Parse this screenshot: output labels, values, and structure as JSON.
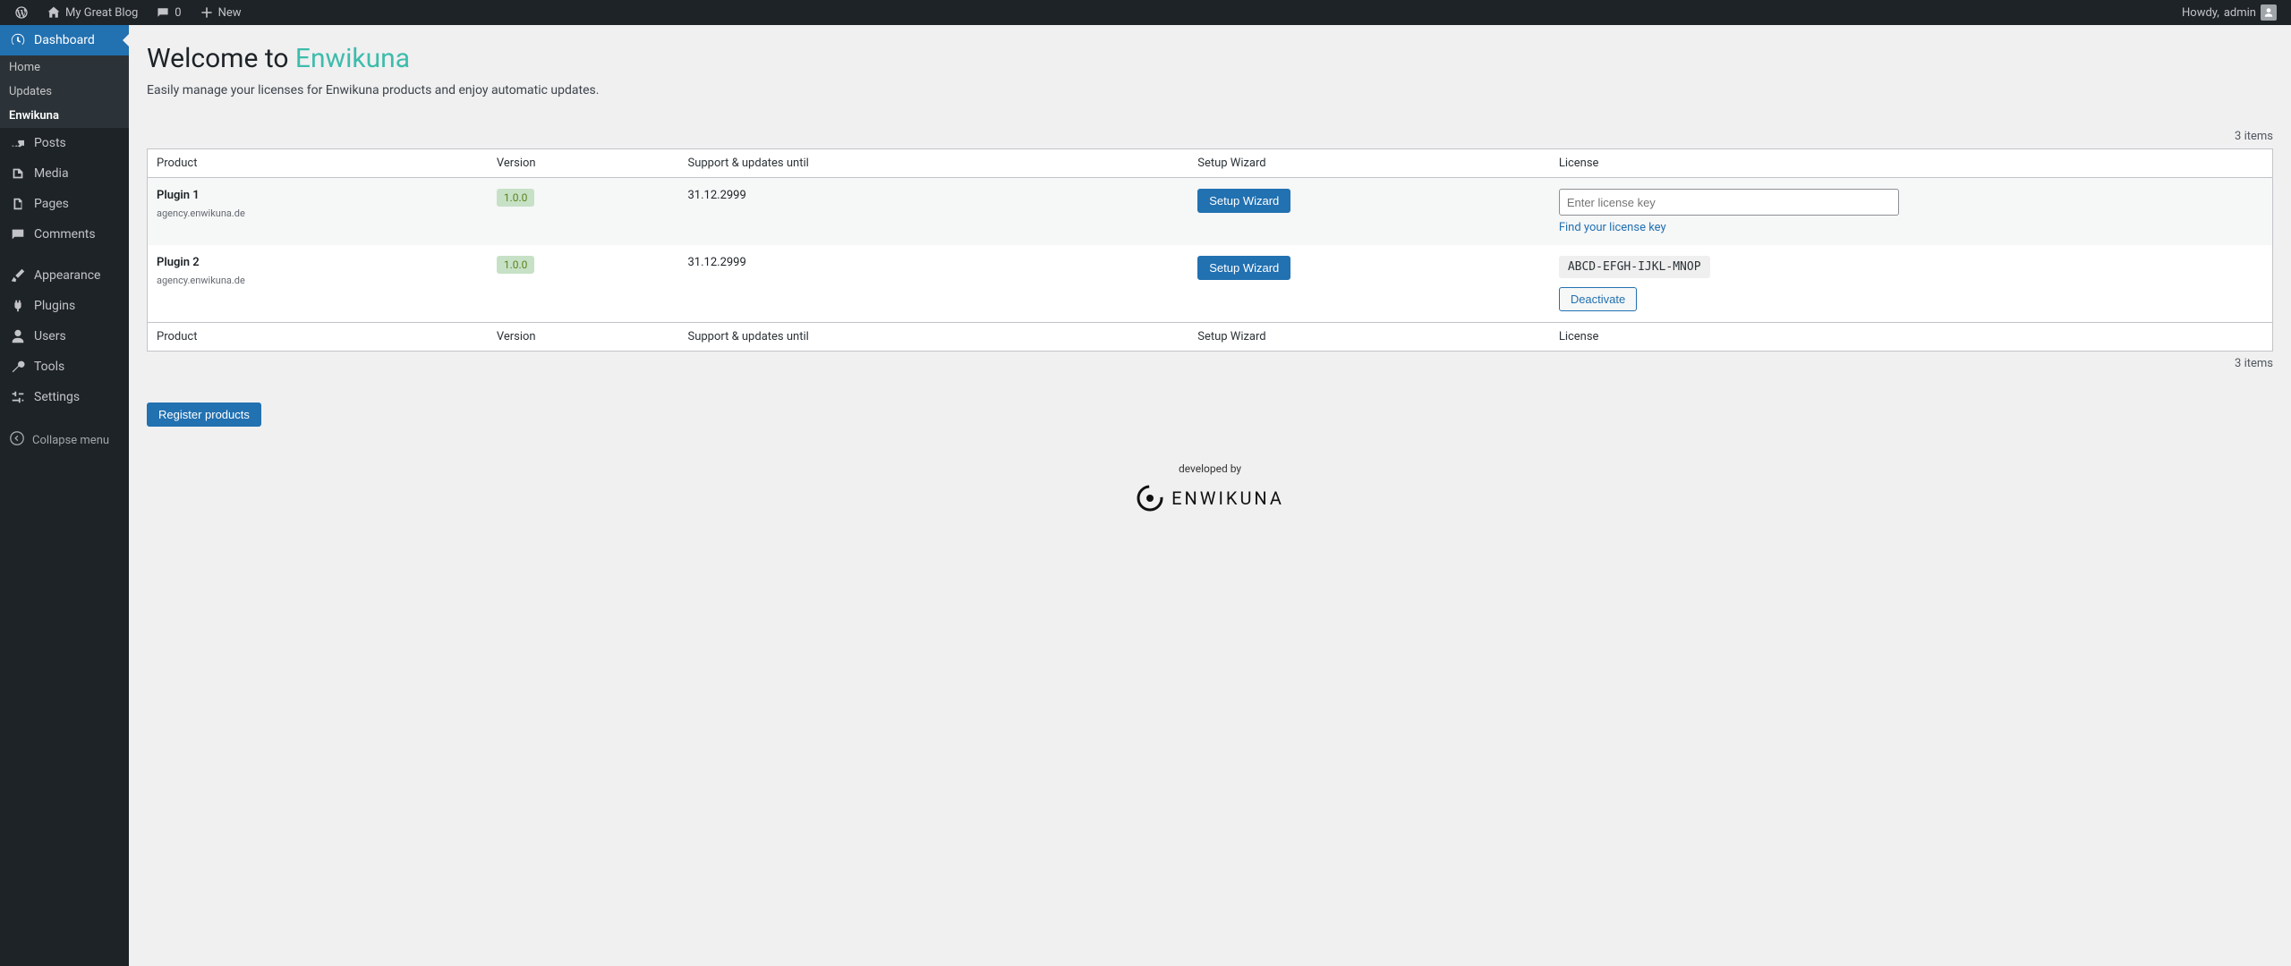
{
  "adminbar": {
    "site_name": "My Great Blog",
    "comments_count": "0",
    "new_label": "New",
    "howdy_prefix": "Howdy,",
    "user": "admin"
  },
  "sidebar": {
    "dashboard": "Dashboard",
    "submenu": {
      "home": "Home",
      "updates": "Updates",
      "enwikuna": "Enwikuna"
    },
    "posts": "Posts",
    "media": "Media",
    "pages": "Pages",
    "comments": "Comments",
    "appearance": "Appearance",
    "plugins": "Plugins",
    "users": "Users",
    "tools": "Tools",
    "settings": "Settings",
    "collapse": "Collapse menu"
  },
  "page": {
    "title_prefix": "Welcome to ",
    "title_brand": "Enwikuna",
    "subtitle": "Easily manage your licenses for Enwikuna products and enjoy automatic updates.",
    "items_count_top": "3 items",
    "items_count_bottom": "3 items",
    "register_button": "Register products",
    "developed_by": "developed by",
    "footer_brand": "ENWIKUNA"
  },
  "table": {
    "headers": {
      "product": "Product",
      "version": "Version",
      "support": "Support & updates until",
      "wizard": "Setup Wizard",
      "license": "License"
    },
    "rows": [
      {
        "name": "Plugin 1",
        "domain": "agency.enwikuna.de",
        "version": "1.0.0",
        "support_until": "31.12.2999",
        "wizard_label": "Setup Wizard",
        "license_placeholder": "Enter license key",
        "find_link": "Find your license key"
      },
      {
        "name": "Plugin 2",
        "domain": "agency.enwikuna.de",
        "version": "1.0.0",
        "support_until": "31.12.2999",
        "wizard_label": "Setup Wizard",
        "license_code": "ABCD-EFGH-IJKL-MNOP",
        "deactivate_label": "Deactivate"
      }
    ]
  }
}
